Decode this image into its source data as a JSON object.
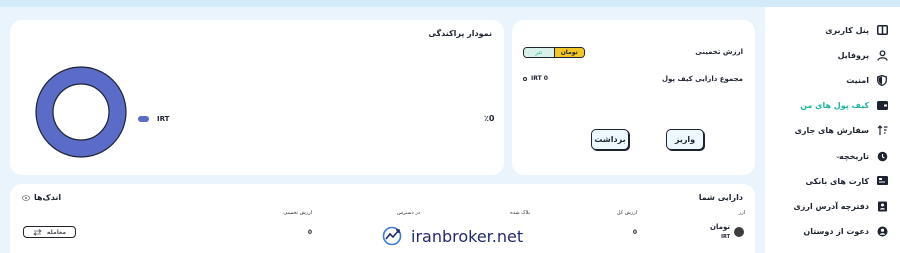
{
  "sidebar": {
    "items": [
      {
        "label": "پنل کاربری",
        "icon": "dashboard-icon"
      },
      {
        "label": "پروفایل",
        "icon": "user-icon"
      },
      {
        "label": "امنیت",
        "icon": "shield-icon"
      },
      {
        "label": "کیف پول های من",
        "icon": "wallet-icon",
        "active": true
      },
      {
        "label": "سفارش های جاری",
        "icon": "sort-icon"
      },
      {
        "label": "تاریخچه",
        "icon": "history-icon",
        "chevron": "⌄"
      },
      {
        "label": "کارت های بانکی",
        "icon": "bank-card-icon"
      },
      {
        "label": "دفترچه آدرس ارزی",
        "icon": "address-book-icon"
      },
      {
        "label": "دعوت از دوستان",
        "icon": "invite-icon"
      }
    ],
    "active_color": "#1cb8a0"
  },
  "chart_card": {
    "title": "نمودار پراکندگی",
    "legend_label": "IRT",
    "percent": "٪0"
  },
  "chart_data": {
    "type": "pie",
    "categories": [
      "IRT"
    ],
    "values": [
      100
    ],
    "colors": [
      "#5a6bc8"
    ]
  },
  "balance_card": {
    "estimated_label": "ارزش تخمینی",
    "toggle_toman": "تومان",
    "toggle_tether": "تتر",
    "total_label": "مجموع دارایی کیف پول",
    "total_value": "IRT 0",
    "deposit_label": "واریز",
    "withdraw_label": "برداشت"
  },
  "assets_card": {
    "title": "دارایی شما",
    "small_label": "اندک‌ها",
    "columns": [
      "ارز",
      "ارزش کل",
      "بلاک شده",
      "در دسترس",
      "ارزش تخمینی"
    ],
    "rows": [
      {
        "name": "تومان",
        "symbol": "IRT",
        "total": "0",
        "estimated": "0"
      }
    ],
    "trade_label": "معامله"
  },
  "watermark": {
    "text": "iranbroker.net"
  }
}
